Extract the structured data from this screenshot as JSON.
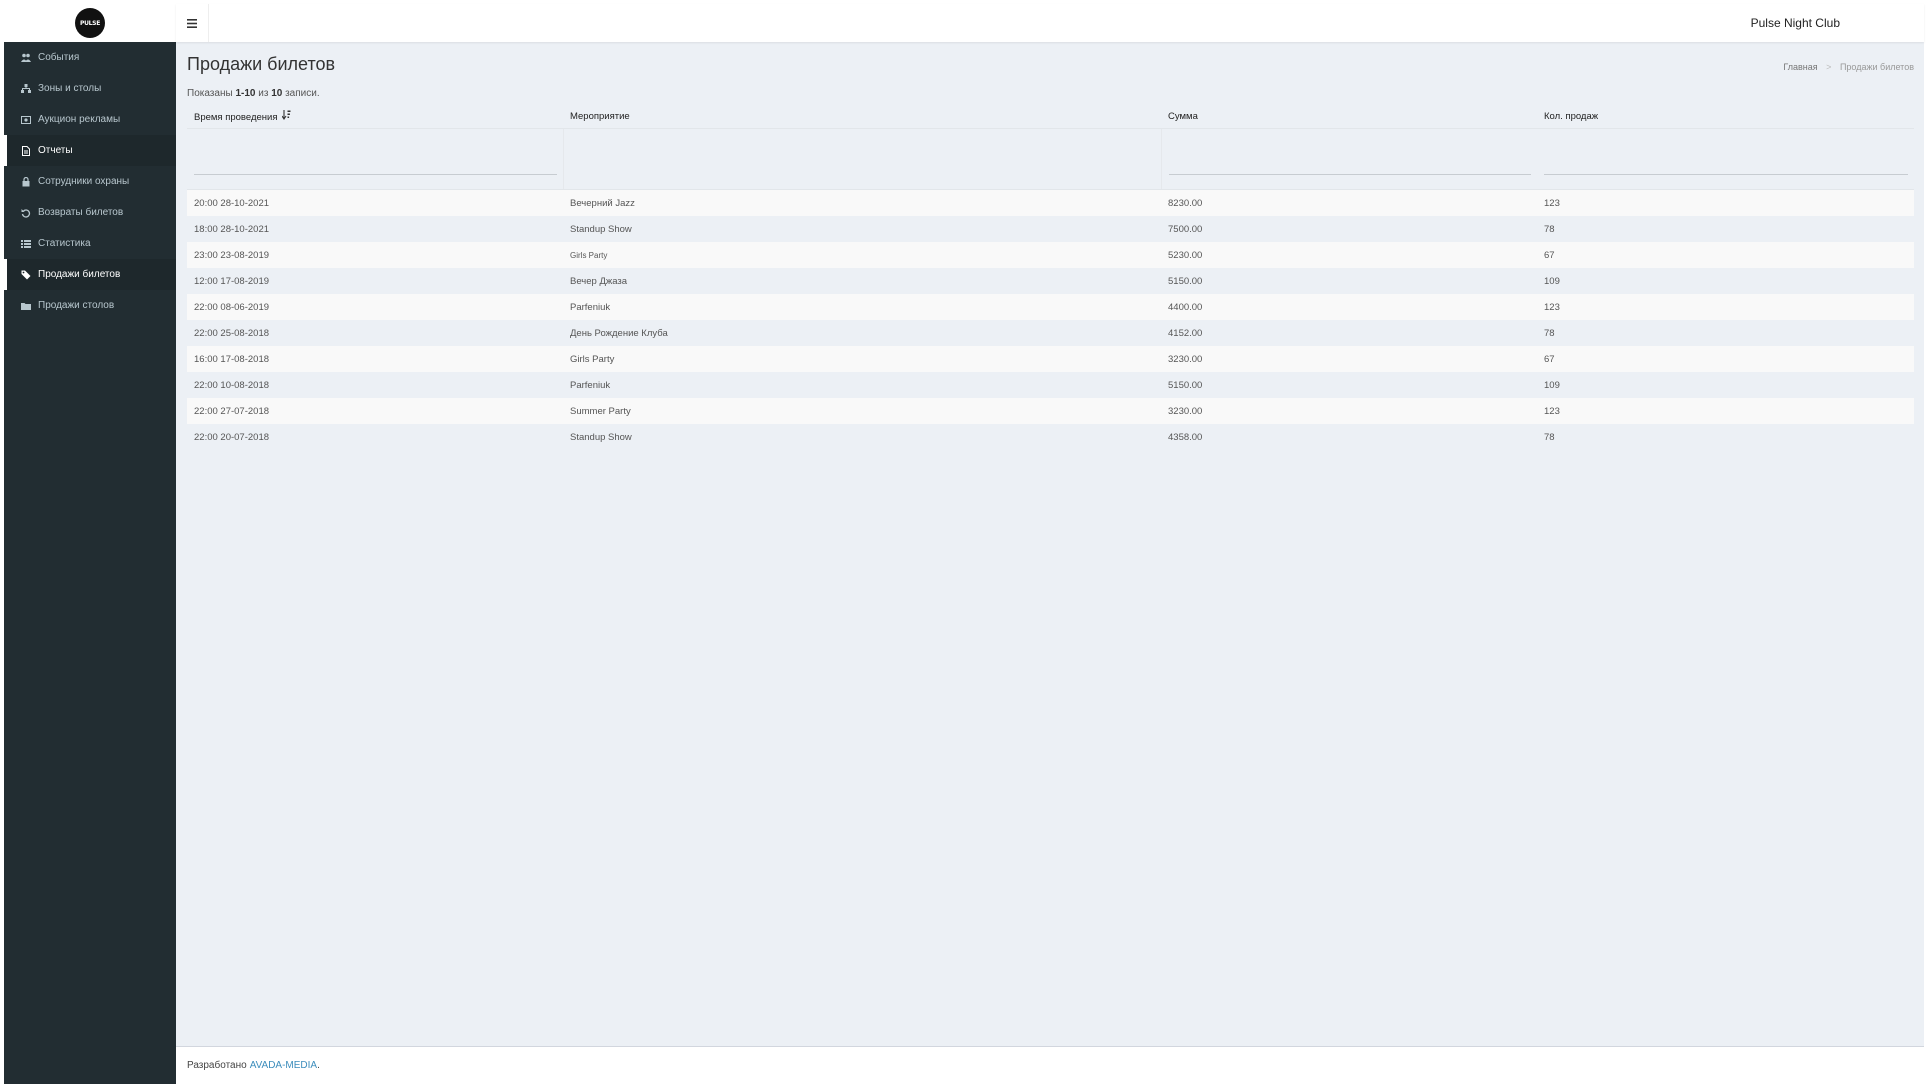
{
  "app": {
    "logo_text": "PULSE",
    "club_name": "Pulse Night Club"
  },
  "sidebar": {
    "items": [
      {
        "label": "События",
        "icon": "users-icon",
        "active": false
      },
      {
        "label": "Зоны и столы",
        "icon": "sitemap-icon",
        "active": false
      },
      {
        "label": "Аукцион рекламы",
        "icon": "money-icon",
        "active": false
      },
      {
        "label": "Отчеты",
        "icon": "file-icon",
        "active": true
      },
      {
        "label": "Сотрудники охраны",
        "icon": "lock-icon",
        "active": false
      },
      {
        "label": "Возвраты билетов",
        "icon": "undo-icon",
        "active": false
      },
      {
        "label": "Статистика",
        "icon": "list-icon",
        "active": false
      },
      {
        "label": "Продажи билетов",
        "icon": "ticket-icon",
        "active": true
      },
      {
        "label": "Продажи столов",
        "icon": "folder-icon",
        "active": false
      }
    ]
  },
  "page": {
    "title": "Продажи билетов",
    "breadcrumb": {
      "home": "Главная",
      "separator": ">",
      "current": "Продажи билетов"
    },
    "summary": {
      "prefix": "Показаны",
      "range": "1-10",
      "of": "из",
      "total": "10",
      "suffix": "записи."
    }
  },
  "table": {
    "headers": [
      "Время проведения",
      "Мероприятие",
      "Сумма",
      "Кол. продаж"
    ],
    "rows": [
      [
        "20:00 28-10-2021",
        "Вечерний Jazz",
        "8230.00",
        "123"
      ],
      [
        "18:00 28-10-2021",
        "Standup Show",
        "7500.00",
        "78"
      ],
      [
        "23:00 23-08-2019",
        "Girls Party",
        "5230.00",
        "67"
      ],
      [
        "12:00 17-08-2019",
        "Вечер Джаза",
        "5150.00",
        "109"
      ],
      [
        "22:00 08-06-2019",
        "Parfeniuk",
        "4400.00",
        "123"
      ],
      [
        "22:00 25-08-2018",
        "День Рождение Клуба",
        "4152.00",
        "78"
      ],
      [
        "16:00 17-08-2018",
        "Girls Party",
        "3230.00",
        "67"
      ],
      [
        "22:00 10-08-2018",
        "Parfeniuk",
        "5150.00",
        "109"
      ],
      [
        "22:00 27-07-2018",
        "Summer Party",
        "3230.00",
        "123"
      ],
      [
        "22:00 20-07-2018",
        "Standup Show",
        "4358.00",
        "78"
      ]
    ]
  },
  "footer": {
    "prefix": "Разработано",
    "link": "AVADA-MEDIA",
    "suffix": "."
  },
  "colors": {
    "sidebar_bg": "#222d32",
    "content_bg": "#ecf0f5",
    "link": "#3c8dbc"
  }
}
